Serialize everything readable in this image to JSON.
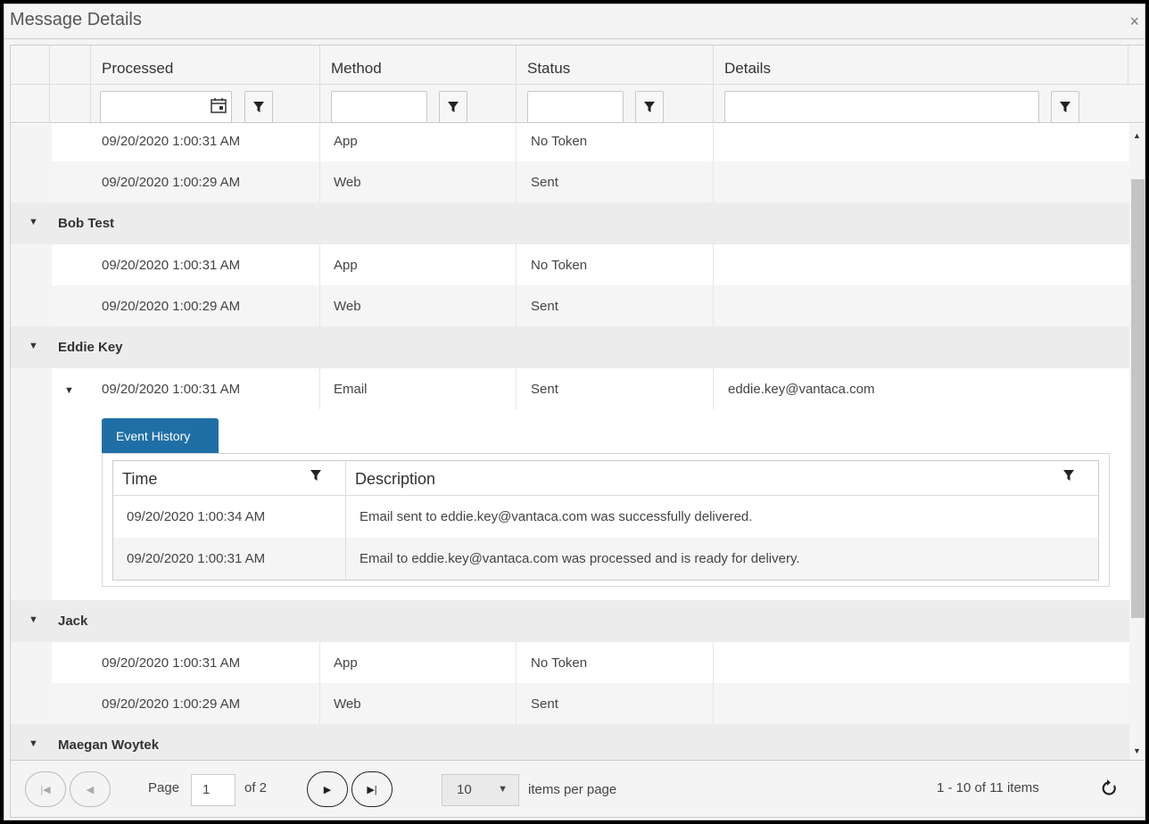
{
  "window": {
    "title": "Message Details",
    "close_glyph": "×"
  },
  "grid": {
    "columns": [
      "Processed",
      "Method",
      "Status",
      "Details"
    ],
    "rows_top": [
      {
        "processed": "09/20/2020 1:00:31 AM",
        "method": "App",
        "status": "No Token",
        "details": ""
      },
      {
        "processed": "09/20/2020 1:00:29 AM",
        "method": "Web",
        "status": "Sent",
        "details": ""
      }
    ],
    "groups": [
      {
        "name": "Bob Test",
        "rows": [
          {
            "processed": "09/20/2020 1:00:31 AM",
            "method": "App",
            "status": "No Token",
            "details": ""
          },
          {
            "processed": "09/20/2020 1:00:29 AM",
            "method": "Web",
            "status": "Sent",
            "details": ""
          }
        ]
      },
      {
        "name": "Eddie Key",
        "rows": [
          {
            "processed": "09/20/2020 1:00:31 AM",
            "method": "Email",
            "status": "Sent",
            "details": "eddie.key@vantaca.com"
          }
        ]
      },
      {
        "name": "Jack",
        "rows": [
          {
            "processed": "09/20/2020 1:00:31 AM",
            "method": "App",
            "status": "No Token",
            "details": ""
          },
          {
            "processed": "09/20/2020 1:00:29 AM",
            "method": "Web",
            "status": "Sent",
            "details": ""
          }
        ]
      },
      {
        "name": "Maegan Woytek",
        "rows": []
      }
    ]
  },
  "event_history": {
    "tab_label": "Event History",
    "columns": [
      "Time",
      "Description"
    ],
    "rows": [
      {
        "time": "09/20/2020 1:00:34 AM",
        "description": "Email sent to eddie.key@vantaca.com was successfully delivered."
      },
      {
        "time": "09/20/2020 1:00:31 AM",
        "description": "Email to eddie.key@vantaca.com was processed and is ready for delivery."
      }
    ]
  },
  "pager": {
    "page_label": "Page",
    "page_value": "1",
    "of_label": "of 2",
    "page_size": "10",
    "items_per_page_label": "items per page",
    "summary": "1 - 10 of 11 items"
  },
  "icons": {
    "filter": "filter-icon",
    "calendar": "calendar-icon",
    "collapse": "caret-down-icon",
    "first": "first-page-icon",
    "prev": "previous-page-icon",
    "next": "next-page-icon",
    "last": "last-page-icon",
    "refresh": "refresh-icon"
  },
  "colors": {
    "tab_accent": "#1f6fa6"
  }
}
